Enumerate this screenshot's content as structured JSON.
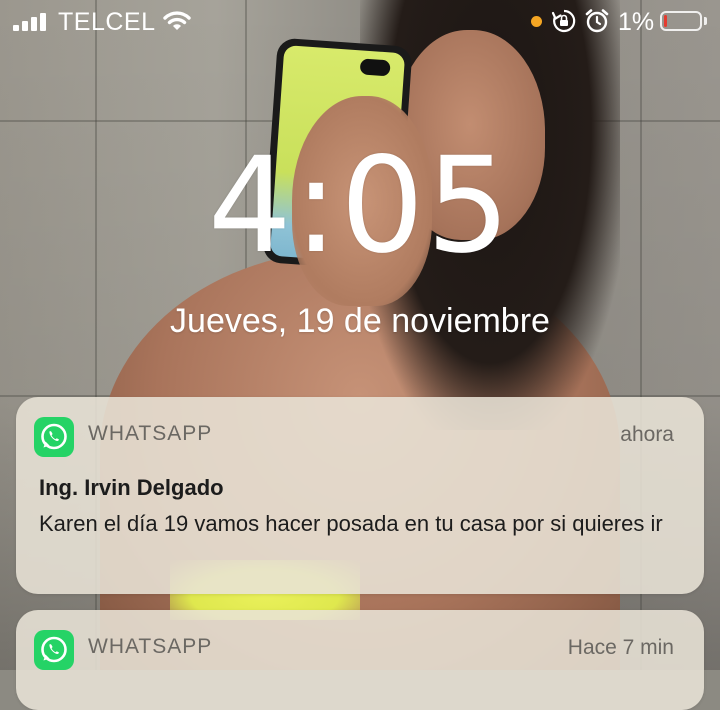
{
  "status_bar": {
    "carrier": "TELCEL",
    "battery_percent": "1%",
    "battery_level": 0.01,
    "icons": [
      "signal-icon",
      "wifi-icon",
      "orientation-lock-icon",
      "alarm-icon",
      "battery-icon"
    ],
    "battery_fill_color": "#e53b2f",
    "indicator_dot_color": "#f5a623"
  },
  "lock_screen": {
    "time": "4:05",
    "date": "Jueves, 19 de noviembre"
  },
  "notifications": [
    {
      "app": "WHATSAPP",
      "time": "ahora",
      "sender": "Ing. Irvin Delgado",
      "message": "Karen el día 19 vamos hacer posada en tu casa por si quieres  ir",
      "icon": "whatsapp-icon"
    },
    {
      "app": "WHATSAPP",
      "time": "Hace 7 min",
      "icon": "whatsapp-icon"
    }
  ],
  "colors": {
    "whatsapp_green": "#25d366",
    "notification_bg": "#e8e2d6"
  }
}
